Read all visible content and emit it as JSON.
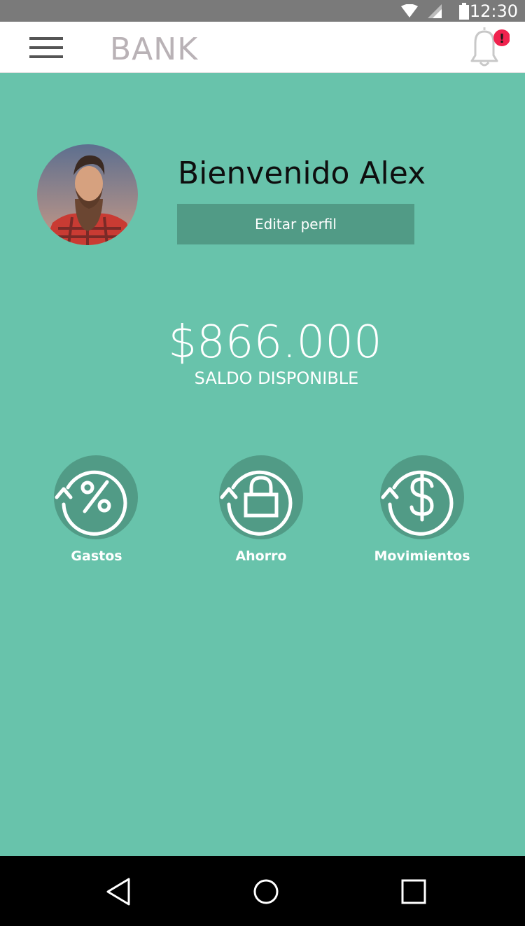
{
  "status_bar": {
    "time": "12:30"
  },
  "app_bar": {
    "brand": "BANK",
    "notification_badge": "!"
  },
  "profile": {
    "welcome_text": "Bienvenido Alex",
    "edit_button_label": "Editar perfil"
  },
  "balance": {
    "amount": "$866.000",
    "label": "SALDO DISPONIBLE"
  },
  "actions": [
    {
      "label": "Gastos",
      "icon": "percent-icon"
    },
    {
      "label": "Ahorro",
      "icon": "lock-icon"
    },
    {
      "label": "Movimientos",
      "icon": "dollar-icon"
    }
  ],
  "colors": {
    "background": "#68c3ab",
    "button": "#519b86",
    "badge": "#f0234e",
    "brand": "#b9b2b6"
  }
}
